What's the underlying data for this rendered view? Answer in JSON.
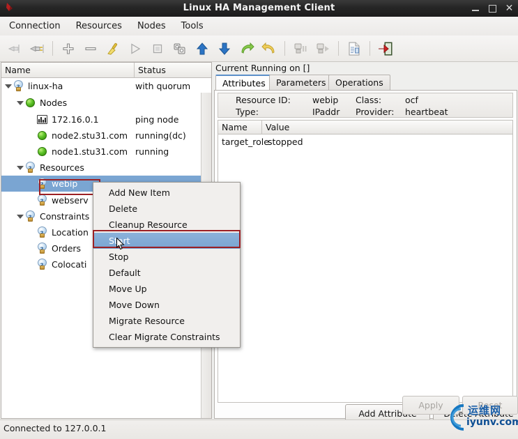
{
  "window": {
    "title": "Linux HA Management Client",
    "app_icon": "app-icon",
    "minimize": "minimize",
    "maximize": "maximize",
    "close": "close"
  },
  "menubar": {
    "items": [
      {
        "label": "Connection"
      },
      {
        "label": "Resources"
      },
      {
        "label": "Nodes"
      },
      {
        "label": "Tools"
      }
    ]
  },
  "toolbar": {
    "items": [
      {
        "name": "connect-icon",
        "title": "Connect"
      },
      {
        "name": "disconnect-icon",
        "title": "Disconnect"
      },
      {
        "name": "add-icon",
        "title": "Add"
      },
      {
        "name": "remove-icon",
        "title": "Remove"
      },
      {
        "name": "cleanup-broom-icon",
        "title": "Cleanup"
      },
      {
        "name": "start-play-icon",
        "title": "Start"
      },
      {
        "name": "stop-square-icon",
        "title": "Stop"
      },
      {
        "name": "default-gears-icon",
        "title": "Default"
      },
      {
        "name": "move-up-icon",
        "title": "Move Up"
      },
      {
        "name": "move-down-icon",
        "title": "Move Down"
      },
      {
        "name": "migrate-icon",
        "title": "Migrate Resource"
      },
      {
        "name": "unmigrate-icon",
        "title": "Clear Migrate Constraints"
      },
      {
        "name": "standby-icon",
        "title": "Standby"
      },
      {
        "name": "active-icon",
        "title": "Active"
      },
      {
        "name": "cib-document-icon",
        "title": "CIB"
      },
      {
        "name": "quit-icon",
        "title": "Quit"
      }
    ]
  },
  "tree": {
    "columns": [
      "Name",
      "Status"
    ],
    "rows": [
      {
        "label": "linux-ha",
        "status": "with quorum",
        "icon": "bulb-icon",
        "indent": 0,
        "twisty": true
      },
      {
        "label": "Nodes",
        "status": "",
        "icon": "green-ball-icon",
        "indent": 1,
        "twisty": true
      },
      {
        "label": "172.16.0.1",
        "status": "ping node",
        "icon": "ping-node-icon",
        "indent": 2,
        "twisty": false
      },
      {
        "label": "node2.stu31.com",
        "status": "running(dc)",
        "icon": "green-ball-icon",
        "indent": 2,
        "twisty": false
      },
      {
        "label": "node1.stu31.com",
        "status": "running",
        "icon": "green-ball-icon",
        "indent": 2,
        "twisty": false
      },
      {
        "label": "Resources",
        "status": "",
        "icon": "bulb-icon",
        "indent": 1,
        "twisty": true
      },
      {
        "label": "webip",
        "status": "",
        "icon": "bulb-icon",
        "indent": 2,
        "twisty": false,
        "selected": true
      },
      {
        "label": "webserv",
        "status": "",
        "icon": "bulb-icon",
        "indent": 2,
        "twisty": false
      },
      {
        "label": "Constraints",
        "status": "",
        "icon": "bulb-icon",
        "indent": 1,
        "twisty": true
      },
      {
        "label": "Location",
        "status": "",
        "icon": "bulb-icon",
        "indent": 2,
        "twisty": false
      },
      {
        "label": "Orders",
        "status": "",
        "icon": "bulb-icon",
        "indent": 2,
        "twisty": false
      },
      {
        "label": "Colocati",
        "status": "",
        "icon": "bulb-icon",
        "indent": 2,
        "twisty": false
      }
    ]
  },
  "context_menu": {
    "items": [
      {
        "label": "Add New Item",
        "active": false
      },
      {
        "label": "Delete",
        "active": false
      },
      {
        "label": "Cleanup Resource",
        "active": false
      },
      {
        "label": "Start",
        "active": true
      },
      {
        "label": "Stop",
        "active": false
      },
      {
        "label": "Default",
        "active": false
      },
      {
        "label": "Move Up",
        "active": false
      },
      {
        "label": "Move Down",
        "active": false
      },
      {
        "label": "Migrate Resource",
        "active": false
      },
      {
        "label": "Clear Migrate Constraints",
        "active": false
      }
    ]
  },
  "details": {
    "running_label": "Current Running on []",
    "tabs": [
      {
        "label": "Attributes",
        "active": true
      },
      {
        "label": "Parameters",
        "active": false
      },
      {
        "label": "Operations",
        "active": false
      }
    ],
    "meta": {
      "resource_id_label": "Resource ID:",
      "resource_id_value": "webip",
      "class_label": "Class:",
      "class_value": "ocf",
      "type_label": "Type:",
      "type_value": "IPaddr",
      "provider_label": "Provider:",
      "provider_value": "heartbeat"
    },
    "attr_columns": [
      "Name",
      "Value"
    ],
    "attr_rows": [
      {
        "name": "target_role",
        "value": "stopped"
      }
    ],
    "buttons": {
      "add_attribute": "Add Attribute",
      "delete_attribute": "Delete Attribute",
      "apply": "Apply",
      "reset": "Reset"
    }
  },
  "statusbar": {
    "text": "Connected to 127.0.0.1"
  },
  "watermark": {
    "cn": "运维网",
    "en": "iyunv.com"
  },
  "colors": {
    "selection": "#7aa5d2",
    "marker_red": "#9c2024",
    "tab_accent": "#5b8fc9",
    "titlebar": "#262626"
  }
}
